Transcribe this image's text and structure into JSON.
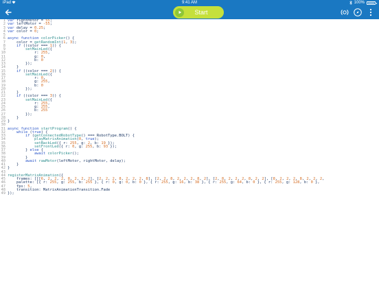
{
  "status_bar": {
    "carrier": "iPad",
    "time": "9:41 AM",
    "battery": "100%"
  },
  "toolbar": {
    "start_label": "Start"
  },
  "colors": {
    "toolbar_bg": "#1a78c2",
    "start_button_bg": "#c5e03c",
    "play_icon_bg": "#8ec637",
    "keyword": "#2b56c8",
    "number": "#d46a1e",
    "function": "#2f8f8f",
    "identifier": "#1f3a66",
    "line_number": "#9a9a9a"
  },
  "editor": {
    "lines": [
      "var rightMotor = 55;",
      "var leftMotor = -55;",
      "var delay = 0.25;",
      "var color = 0;",
      "",
      "async function colorPicker() {",
      "    color = getRandomInt(1, 3);",
      "    if ((color === 1)) {",
      "        setMainLed({",
      "            r: 255,",
      "            g: 0,",
      "            b: 0",
      "        });",
      "    }",
      "    if ((color === 2)) {",
      "        setMainLed({",
      "            r: 0,",
      "            g: 255,",
      "            b: 0",
      "        });",
      "    }",
      "    if ((color === 3)) {",
      "        setMainLed({",
      "            r: 255,",
      "            g: 255,",
      "            b: 255",
      "        });",
      "    }",
      "}",
      "",
      "async function startProgram() {",
      "    while (true) {",
      "        if (getConnectedRobotType() === RobotType.BOLT) {",
      "            playMatrixAnimation(0, true);",
      "            setBackLed({ r: 255, g: 2, b: 19 });",
      "            setFrontLed({ r: 0, g: 255, b: 93 });",
      "        } else {",
      "            await colorPicker();",
      "        }",
      "        await rawMotor(leftMotor, rightMotor, delay);",
      "    }",
      "}",
      "",
      "registerMatrixAnimation({",
      "    frames: [[[6, 2, 2, 2, 8, 2, 2, 2], [2, 2, 2, 8, 2, 2, 2, 8], [2, 2, 8, 2, 2, 2, 8, 2], [2, 8, 2, 2, 2, 8, 2, 2], [8, 2, 2, 2, 8, 2, 2, 2,",
      "    palette: [{ r: 255, g: 255, b: 255 }, { r: 0, g: 0, b: 0 }, { r: 255, g: 16, b: 38 }, { r: 255, g: 64, b: 0 }, { r: 255, g: 128, b: 0 },",
      "    fps: 5,",
      "    transition: MatrixAnimationTransition.Fade",
      "});"
    ]
  }
}
